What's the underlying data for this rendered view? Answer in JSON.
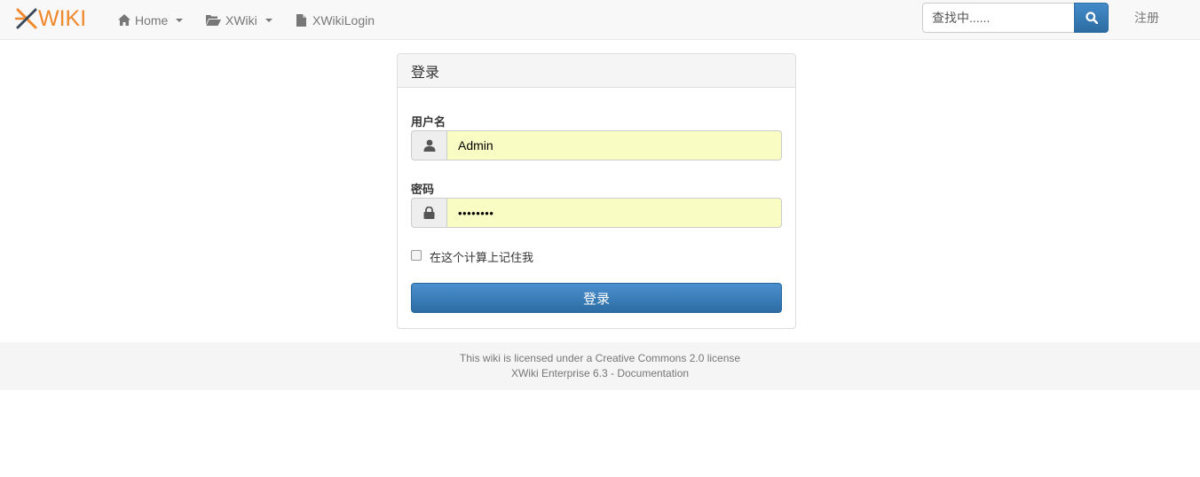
{
  "navbar": {
    "logo_text": "WIKI",
    "brand_color": "#f0882c",
    "items": [
      {
        "label": "Home",
        "icon": "home-icon"
      },
      {
        "label": "XWiki",
        "icon": "folder-open-icon"
      },
      {
        "label": "XWikiLogin",
        "icon": "file-icon"
      }
    ],
    "search": {
      "placeholder": "查找中......",
      "icon": "search-icon"
    },
    "register_label": "注册"
  },
  "login": {
    "title": "登录",
    "username": {
      "label": "用户名",
      "value": "Admin",
      "icon": "user-icon"
    },
    "password": {
      "label": "密码",
      "value": "••••••••",
      "icon": "lock-icon"
    },
    "remember_label": "在这个计算上记住我",
    "remember_checked": false,
    "submit_label": "登录",
    "field_bg": "#fafdc3",
    "button_color": "#337ab7"
  },
  "footer": {
    "license_prefix": "This wiki is licensed under a ",
    "license_link": "Creative Commons 2.0",
    "license_suffix": " license",
    "product": "XWiki Enterprise 6.3",
    "separator": " - ",
    "docs_link": "Documentation"
  }
}
